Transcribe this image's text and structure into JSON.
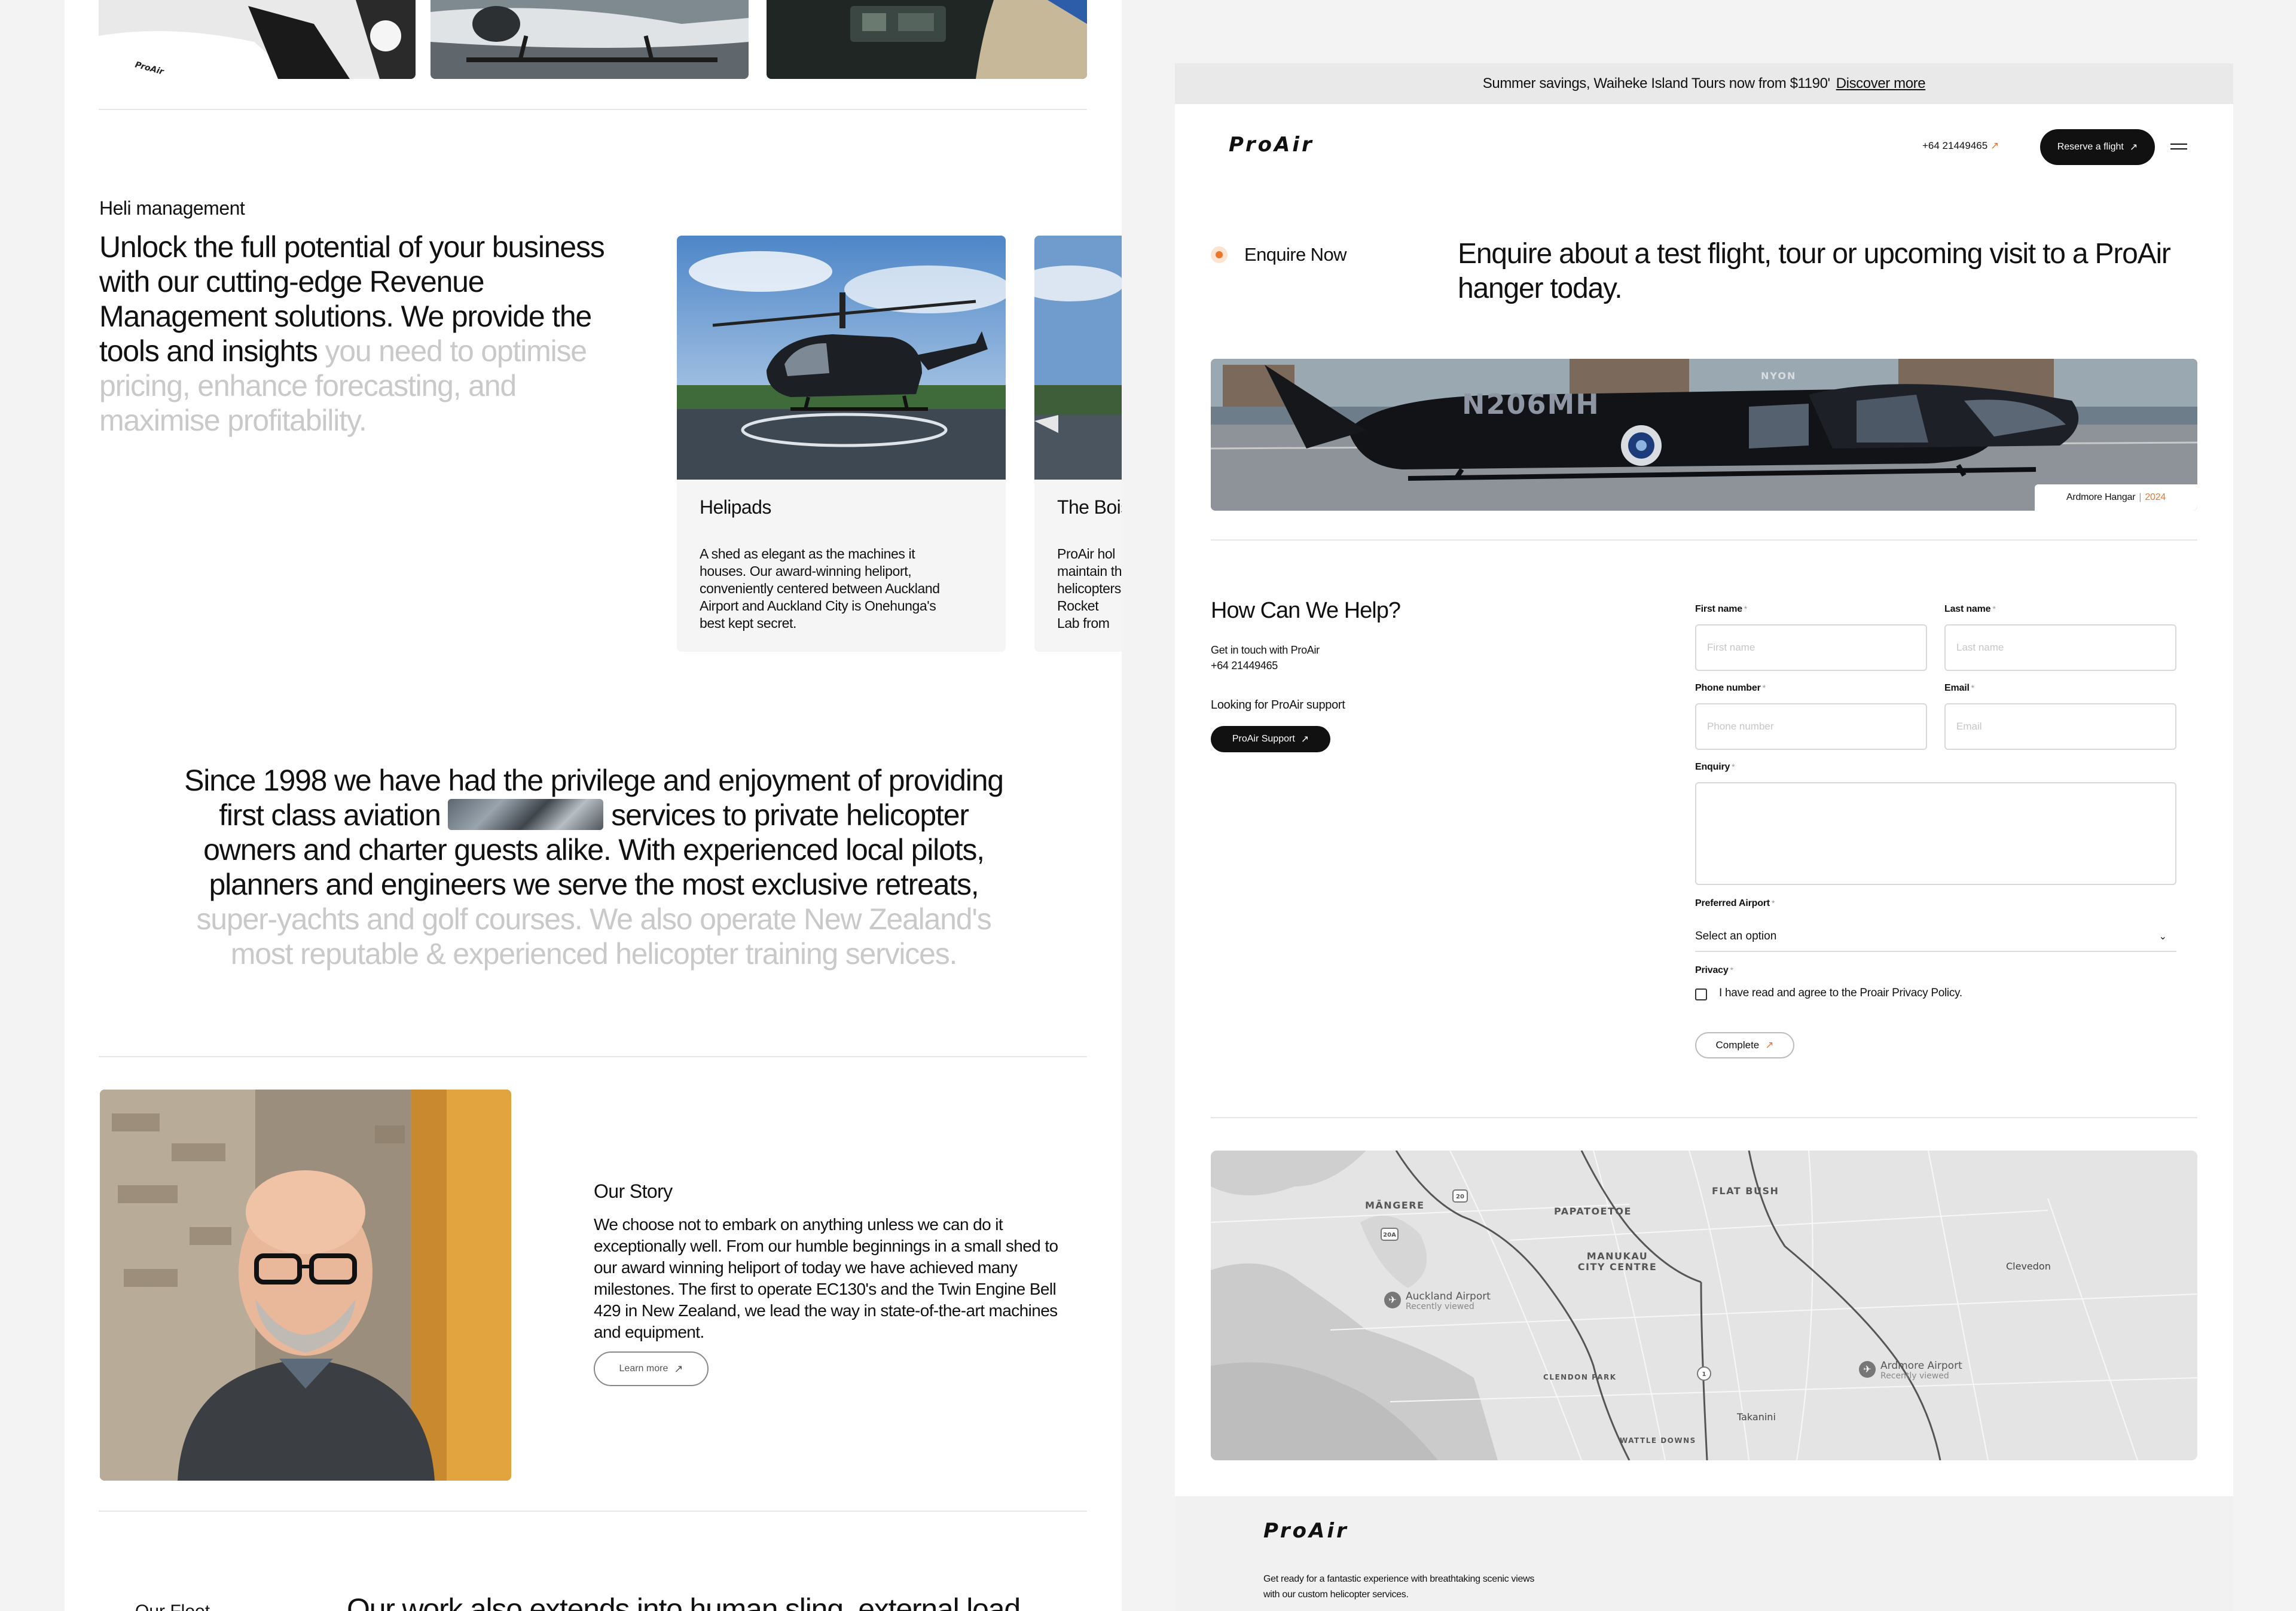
{
  "left": {
    "heli_management": {
      "eyebrow": "Heli management",
      "lead_dark": "Unlock the full potential of your business with our cutting-edge Revenue Management solutions. We provide the tools and insights",
      "lead_faded": " you need to optimise pricing, enhance forecasting, and maximise profitability."
    },
    "cards": [
      {
        "title": "Helipads",
        "text": "A shed as elegant as the machines it houses. Our award-winning heliport, conveniently centered between Auckland Airport and Auckland City is Onehunga's best kept secret."
      },
      {
        "title": "The Bois",
        "text": "ProAir hol maintain th helicopters Rocket Lab from ProAi"
      }
    ],
    "since": {
      "part1": "Since 1998 we have had the privilege and enjoyment of providing first class aviation",
      "part2": " services to private helicopter owners and charter guests alike. With experienced local pilots, planners and engineers we serve the most exclusive retreats,",
      "faded": " super-yachts and golf courses. We also operate New Zealand's most reputable & experienced helicopter training services."
    },
    "story": {
      "title": "Our Story",
      "text": "We choose not to embark on anything unless we can do it exceptionally well. From our humble beginnings in a small shed to our award winning heliport of today we have achieved many milestones. The first to operate EC130's and the Twin Engine Bell 429 in New Zealand, we lead the way in state-of-the-art machines and equipment.",
      "button": "Learn more"
    },
    "bottom": {
      "label": "Our Fleet",
      "text": "Our work also extends into human sling, external load"
    }
  },
  "right": {
    "promo": {
      "text": "Summer savings, Waiheke Island Tours now from $1190'",
      "link": "Discover more"
    },
    "nav": {
      "logo": "ProAir",
      "phone": "+64 21449465",
      "cta": "Reserve a flight"
    },
    "enquire": {
      "tag": "Enquire Now",
      "headline": "Enquire about a test flight, tour or upcoming visit to a ProAir hanger today."
    },
    "hero": {
      "badge_location": "Ardmore Hangar",
      "badge_year": "2024",
      "tail_number": "N206MH",
      "livery_text": "NYON"
    },
    "help": {
      "title": "How Can We Help?",
      "contact_line1": "Get in touch with ProAir",
      "contact_line2": "+64 21449465",
      "support_label": "Looking for ProAir support",
      "support_button": "ProAir Support"
    },
    "form": {
      "first_name_label": "First name",
      "first_name_placeholder": "First name",
      "last_name_label": "Last name",
      "last_name_placeholder": "Last name",
      "phone_label": "Phone number",
      "phone_placeholder": "Phone number",
      "email_label": "Email",
      "email_placeholder": "Email",
      "enquiry_label": "Enquiry",
      "airport_label": "Preferred Airport",
      "airport_value": "Select an option",
      "privacy_label": "Privacy",
      "privacy_text": "I have read and agree to the Proair Privacy Policy.",
      "required_mark": "*",
      "submit": "Complete"
    },
    "map": {
      "labels": [
        "MĀNGERE",
        "PAPATOETOE",
        "FLAT BUSH",
        "MANUKAU CITY CENTRE",
        "Clevedon",
        "CLENDON PARK",
        "Takanini",
        "WATTLE DOWNS"
      ],
      "route_badges": [
        "20",
        "20A",
        "1"
      ],
      "pins": [
        {
          "name": "Auckland Airport",
          "sub": "Recently viewed"
        },
        {
          "name": "Ardmore Airport",
          "sub": "Recently viewed"
        }
      ]
    },
    "footer": {
      "logo": "ProAir",
      "text": "Get ready for a fantastic experience with breathtaking scenic views with our custom helicopter services."
    }
  },
  "colors": {
    "accent": "#e8762c",
    "dark": "#111111",
    "faded_text": "#c9c9c9"
  }
}
